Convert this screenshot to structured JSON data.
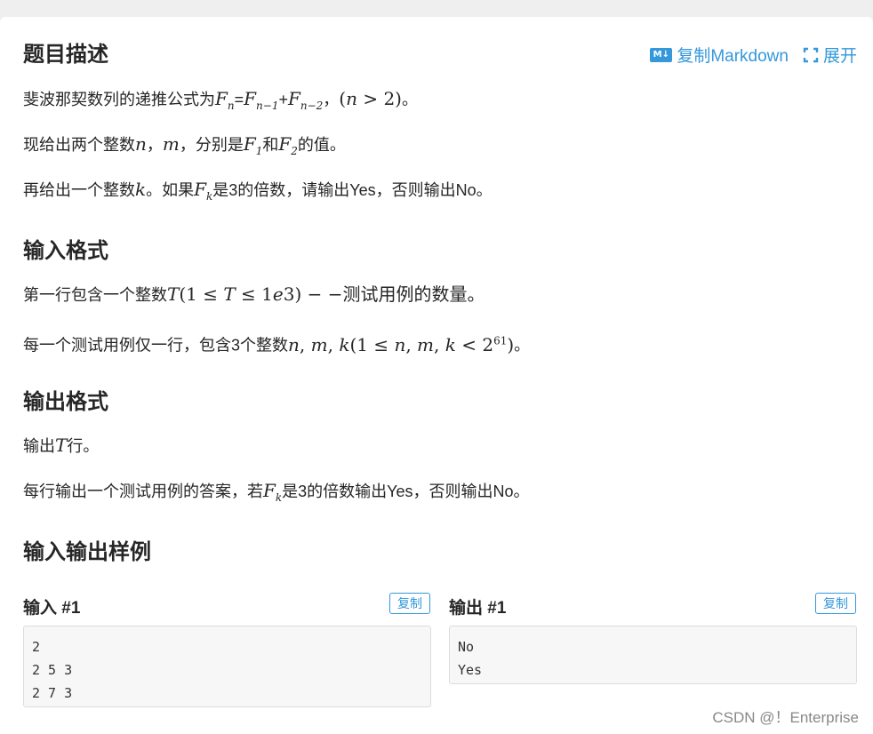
{
  "toolbar": {
    "copy_markdown": "复制Markdown",
    "expand": "展开",
    "md_icon_text": "M↓"
  },
  "sections": {
    "description_title": "题目描述",
    "desc_line1_pre": "斐波那契数列的递推公式为",
    "desc_line1_post": "。",
    "desc_line2_pre": "现给出两个整数",
    "desc_line2_mid": "，分别是",
    "desc_line2_and": "和",
    "desc_line2_post": "的值。",
    "desc_line3_pre": "再给出一个整数",
    "desc_line3_mid": "。如果",
    "desc_line3_post": "是3的倍数，请输出Yes，否则输出No。",
    "input_title": "输入格式",
    "input_line1_pre": "第一行包含一个整数",
    "input_line1_post": "测试用例的数量。",
    "input_line2_pre": "每一个测试用例仅一行，包含3个整数",
    "input_line2_post": "。",
    "output_title": "输出格式",
    "output_line1_pre": "输出",
    "output_line1_post": "行。",
    "output_line2_pre": "每行输出一个测试用例的答案，若",
    "output_line2_post": "是3的倍数输出Yes，否则输出No。",
    "samples_title": "输入输出样例"
  },
  "samples": {
    "input_label": "输入 #1",
    "output_label": "输出 #1",
    "copy_label": "复制",
    "input_text": "2\n2 5 3\n2 7 3",
    "output_text": "No\nYes"
  },
  "watermark": "CSDN @！Enterprise",
  "colors": {
    "accent": "#3498db",
    "background": "#efefef",
    "card": "#ffffff"
  }
}
